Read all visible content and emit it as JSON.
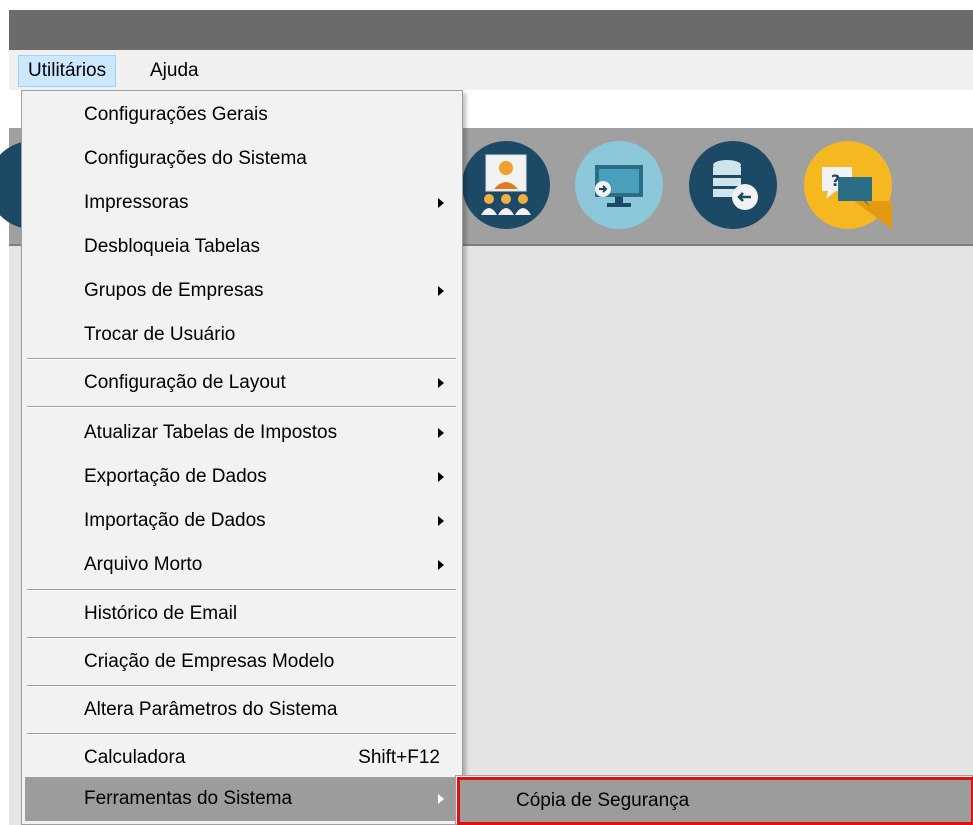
{
  "menubar": {
    "items": [
      {
        "label": "Utilitários",
        "active": true
      },
      {
        "label": "Ajuda",
        "active": false
      }
    ]
  },
  "toolbar": {
    "icons": [
      {
        "name": "partial-circle-icon",
        "color": "#1c4a66"
      },
      {
        "name": "meeting-users-icon",
        "color": "#1c4a66"
      },
      {
        "name": "monitor-export-icon",
        "color": "#8cc8da"
      },
      {
        "name": "database-back-icon",
        "color": "#1c4a66"
      },
      {
        "name": "help-chat-icon",
        "color": "#f5b820"
      }
    ]
  },
  "menu": {
    "items": [
      {
        "label": "Configurações Gerais",
        "submenu": false
      },
      {
        "label": "Configurações do Sistema",
        "submenu": false
      },
      {
        "label": "Impressoras",
        "submenu": true
      },
      {
        "label": "Desbloqueia Tabelas",
        "submenu": false
      },
      {
        "label": "Grupos de Empresas",
        "submenu": true
      },
      {
        "label": "Trocar de Usuário",
        "submenu": false
      },
      {
        "label": "Configuração de Layout",
        "submenu": true
      },
      {
        "label": "Atualizar Tabelas de Impostos",
        "submenu": true
      },
      {
        "label": "Exportação de Dados",
        "submenu": true
      },
      {
        "label": "Importação de Dados",
        "submenu": true
      },
      {
        "label": "Arquivo Morto",
        "submenu": true
      },
      {
        "label": "Histórico de Email",
        "submenu": false
      },
      {
        "label": "Criação de Empresas Modelo",
        "submenu": false
      },
      {
        "label": "Altera Parâmetros do Sistema",
        "submenu": false
      },
      {
        "label": "Calculadora",
        "shortcut": "Shift+F12",
        "submenu": false
      },
      {
        "label": "Ferramentas do Sistema",
        "submenu": true,
        "highlighted": true
      }
    ]
  },
  "submenu": {
    "items": [
      {
        "label": "Cópia de Segurança",
        "highlighted": true,
        "annotation_color": "#e01010"
      }
    ]
  }
}
